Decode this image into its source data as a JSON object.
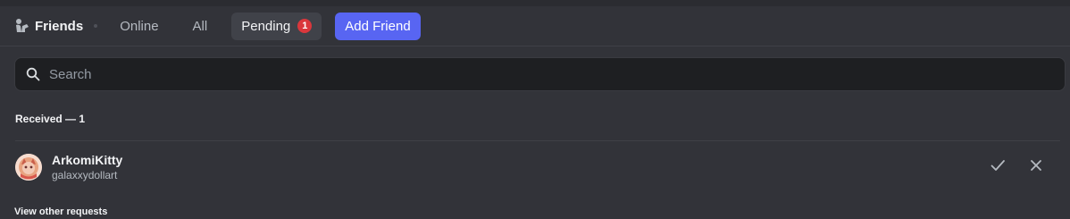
{
  "header": {
    "title": "Friends",
    "tabs": [
      {
        "label": "Online"
      },
      {
        "label": "All"
      },
      {
        "label": "Pending",
        "badge": "1"
      }
    ],
    "add_friend_label": "Add Friend"
  },
  "search": {
    "placeholder": "Search",
    "value": ""
  },
  "received": {
    "label": "Received — 1",
    "requests": [
      {
        "username": "ArkomiKitty",
        "handle": "galaxxydollart"
      }
    ],
    "view_other_label": "View other requests"
  },
  "colors": {
    "background": "#323339",
    "accent": "#5865f2",
    "badge": "#da373c"
  },
  "icons": {
    "header": "friends-waving-icon",
    "search": "search-icon",
    "accept": "check-icon",
    "decline": "close-icon"
  }
}
